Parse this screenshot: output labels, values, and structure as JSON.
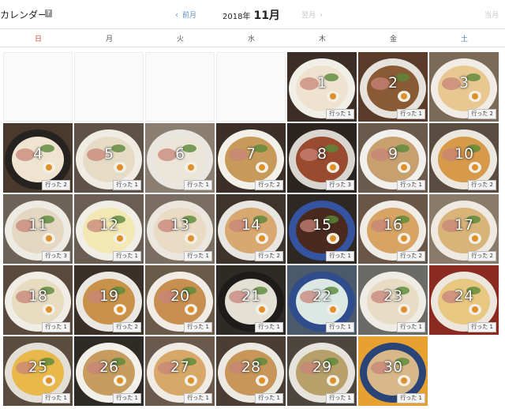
{
  "header": {
    "title": "カレンダー",
    "help_glyph": "?",
    "prev_label": "前月",
    "year_label": "2018年",
    "month_label": "11月",
    "next_label": "翌月",
    "today_label": "当月"
  },
  "weekdays": [
    "日",
    "月",
    "火",
    "水",
    "木",
    "金",
    "土"
  ],
  "first_weekday_index": 4,
  "days": [
    {
      "day": "1",
      "badge": "行った 1",
      "bg": "#3a2e26",
      "bowl": "#f2efe8",
      "soup": "#efe2cf"
    },
    {
      "day": "2",
      "badge": "行った 1",
      "bg": "#5a3b2a",
      "bowl": "#e6e3dd",
      "soup": "#8a5a35"
    },
    {
      "day": "3",
      "badge": "行った 2",
      "bg": "#7b6a58",
      "bowl": "#f1ede6",
      "soup": "#e8c890"
    },
    {
      "day": "4",
      "badge": "行った 2",
      "bg": "#4a3a2e",
      "bowl": "#262220",
      "soup": "#efe4cf"
    },
    {
      "day": "5",
      "badge": "行った 1",
      "bg": "#5e5248",
      "bowl": "#f0ece4",
      "soup": "#e6dcc6"
    },
    {
      "day": "6",
      "badge": "行った 1",
      "bg": "#8a7e70",
      "bowl": "#e9e6e0",
      "soup": "#ece6d8"
    },
    {
      "day": "7",
      "badge": "行った 2",
      "bg": "#3b2f28",
      "bowl": "#f3f0ea",
      "soup": "#c89a5a"
    },
    {
      "day": "8",
      "badge": "行った 3",
      "bg": "#2c2420",
      "bowl": "#d9d5cf",
      "soup": "#9a4a2e"
    },
    {
      "day": "9",
      "badge": "行った 1",
      "bg": "#6a5a4c",
      "bowl": "#f2f0ec",
      "soup": "#c8a070"
    },
    {
      "day": "10",
      "badge": "行った 2",
      "bg": "#5a4c40",
      "bowl": "#ece8e0",
      "soup": "#d69a4a"
    },
    {
      "day": "11",
      "badge": "行った 3",
      "bg": "#6c6258",
      "bowl": "#eeeae4",
      "soup": "#e4d8c2"
    },
    {
      "day": "12",
      "badge": "行った 1",
      "bg": "#6a5e54",
      "bowl": "#f1eee8",
      "soup": "#f2e8b4"
    },
    {
      "day": "13",
      "badge": "行った 1",
      "bg": "#7a6e62",
      "bowl": "#ebe6de",
      "soup": "#eadcc4"
    },
    {
      "day": "14",
      "badge": "行った 2",
      "bg": "#3e342c",
      "bowl": "#e8e6e2",
      "soup": "#d8a870"
    },
    {
      "day": "15",
      "badge": "行った 1",
      "bg": "#2e2824",
      "bowl": "#3454a0",
      "soup": "#4a2a1e"
    },
    {
      "day": "16",
      "badge": "行った 2",
      "bg": "#6a5646",
      "bowl": "#f0ece6",
      "soup": "#d8a464"
    },
    {
      "day": "17",
      "badge": "行った 2",
      "bg": "#8a7a6a",
      "bowl": "#efe9e2",
      "soup": "#d8b478"
    },
    {
      "day": "18",
      "badge": "行った 1",
      "bg": "#5a4a3e",
      "bowl": "#f0ece6",
      "soup": "#e8dcc0"
    },
    {
      "day": "19",
      "badge": "行った 2",
      "bg": "#3a3028",
      "bowl": "#ebe8e4",
      "soup": "#c8924a"
    },
    {
      "day": "20",
      "badge": "行った 1",
      "bg": "#6a5a4a",
      "bowl": "#f1ede6",
      "soup": "#c89050"
    },
    {
      "day": "21",
      "badge": "行った 1",
      "bg": "#2e2a26",
      "bowl": "#1e1c1a",
      "soup": "#e4e0d4"
    },
    {
      "day": "22",
      "badge": "行った 1",
      "bg": "#4a5a6a",
      "bowl": "#2f4c8c",
      "soup": "#dce8e4"
    },
    {
      "day": "23",
      "badge": "行った 1",
      "bg": "#6a6a66",
      "bowl": "#efece6",
      "soup": "#e8dcc4"
    },
    {
      "day": "24",
      "badge": "行った 1",
      "bg": "#8a2a20",
      "bowl": "#ece6dc",
      "soup": "#e8c880"
    },
    {
      "day": "25",
      "badge": "行った 1",
      "bg": "#5a4c3e",
      "bowl": "#e4dfd6",
      "soup": "#e8b84a"
    },
    {
      "day": "26",
      "badge": "行った 1",
      "bg": "#2e2a26",
      "bowl": "#f2f0ea",
      "soup": "#c89c5e"
    },
    {
      "day": "27",
      "badge": "行った 1",
      "bg": "#6a5a4e",
      "bowl": "#f0ebe4",
      "soup": "#d8a868"
    },
    {
      "day": "28",
      "badge": "行った 1",
      "bg": "#4a3e34",
      "bowl": "#ece8e2",
      "soup": "#c89658"
    },
    {
      "day": "29",
      "badge": "行った 1",
      "bg": "#4c463e",
      "bowl": "#e6e2dc",
      "soup": "#b8a06a"
    },
    {
      "day": "30",
      "badge": "行った 1",
      "bg": "#e8a030",
      "bowl": "#2a4478",
      "soup": "#d8b888"
    }
  ]
}
